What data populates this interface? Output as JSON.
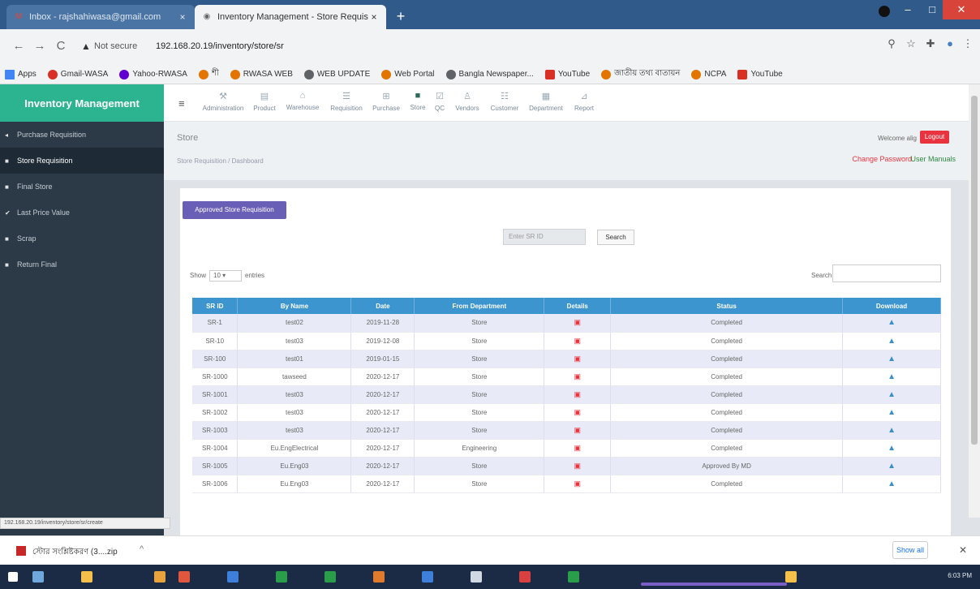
{
  "browser": {
    "tabs": [
      {
        "title": "Inbox - rajshahiwasa@gmail.com",
        "active": false
      },
      {
        "title": "Inventory Management - Store Requisition",
        "active": true
      }
    ],
    "new_tab": "+",
    "controls": {
      "minimize": "–",
      "maximize": "□",
      "close": "✕"
    },
    "nav": {
      "back": "←",
      "forward": "→",
      "reload": "C"
    },
    "security": "Not secure",
    "url": "192.168.20.19/inventory/store/sr",
    "omni_icons": {
      "zoom": "⚲",
      "star": "☆",
      "extensions": "✚",
      "menu": "⋮"
    }
  },
  "bookmarks": [
    {
      "label": "Apps",
      "color": "#4285f4"
    },
    {
      "label": "Gmail-WASA",
      "color": "#d93025"
    },
    {
      "label": "Yahoo-RWASA",
      "color": "#6001d2"
    },
    {
      "label": "শী",
      "color": "#e37400"
    },
    {
      "label": "RWASA WEB",
      "color": "#e37400"
    },
    {
      "label": "WEB UPDATE",
      "color": "#5f6368"
    },
    {
      "label": "Web Portal",
      "color": "#e37400"
    },
    {
      "label": "Bangla Newspaper...",
      "color": "#5f6368"
    },
    {
      "label": "YouTube",
      "color": "#d93025"
    },
    {
      "label": "জাতীয় তথ্য বাতায়ন",
      "color": "#e37400"
    },
    {
      "label": "NCPA",
      "color": "#e37400"
    },
    {
      "label": "YouTube",
      "color": "#d93025"
    }
  ],
  "sidebar": {
    "brand": "Inventory Management",
    "items": [
      {
        "label": "Purchase Requisition",
        "icon": "◂",
        "active": false
      },
      {
        "label": "Store Requisition",
        "icon": "■",
        "active": true
      },
      {
        "label": "Final Store",
        "icon": "■",
        "active": false
      },
      {
        "label": "Last Price Value",
        "icon": "✔",
        "active": false
      },
      {
        "label": "Scrap",
        "icon": "■",
        "active": false
      },
      {
        "label": "Return Final",
        "icon": "■",
        "active": false
      }
    ]
  },
  "topnav": {
    "items": [
      {
        "label": "Administration",
        "icon": "⚒"
      },
      {
        "label": "Product",
        "icon": "▤"
      },
      {
        "label": "Warehouse",
        "icon": "⌂"
      },
      {
        "label": "Requisition",
        "icon": "☰"
      },
      {
        "label": "Purchase",
        "icon": "⊞"
      },
      {
        "label": "Store",
        "icon": "■",
        "active": true
      },
      {
        "label": "QC",
        "icon": "☑"
      },
      {
        "label": "Vendors",
        "icon": "♙"
      },
      {
        "label": "Customer",
        "icon": "☷"
      },
      {
        "label": "Department",
        "icon": "▦"
      },
      {
        "label": "Report",
        "icon": "⊿"
      }
    ]
  },
  "pagehead": {
    "title": "Store",
    "breadcrumb": "Store Requisition / Dashboard",
    "welcome": "Welcome alig",
    "logout": "Logout",
    "change_password": "Change Password",
    "user_manual": "User Manuals"
  },
  "content": {
    "approved_button": "Approved Store Requisition",
    "sr_placeholder": "Enter SR ID",
    "search_button": "Search",
    "show_label": "Show",
    "show_value": "10",
    "entries_label": "entries",
    "search_label": "Search:"
  },
  "table": {
    "columns": [
      "SR ID",
      "By Name",
      "Date",
      "From Department",
      "Details",
      "Status",
      "Download"
    ],
    "rows": [
      [
        "SR-1",
        "test02",
        "2019-11-28",
        "Store",
        "▣",
        "Completed",
        "▲"
      ],
      [
        "SR-10",
        "test03",
        "2019-12-08",
        "Store",
        "▣",
        "Completed",
        "▲"
      ],
      [
        "SR-100",
        "test01",
        "2019-01-15",
        "Store",
        "▣",
        "Completed",
        "▲"
      ],
      [
        "SR-1000",
        "tawseed",
        "2020-12-17",
        "Store",
        "▣",
        "Completed",
        "▲"
      ],
      [
        "SR-1001",
        "test03",
        "2020-12-17",
        "Store",
        "▣",
        "Completed",
        "▲"
      ],
      [
        "SR-1002",
        "test03",
        "2020-12-17",
        "Store",
        "▣",
        "Completed",
        "▲"
      ],
      [
        "SR-1003",
        "test03",
        "2020-12-17",
        "Store",
        "▣",
        "Completed",
        "▲"
      ],
      [
        "SR-1004",
        "Eu.EngElectrical",
        "2020-12-17",
        "Engineering",
        "▣",
        "Completed",
        "▲"
      ],
      [
        "SR-1005",
        "Eu.Eng03",
        "2020-12-17",
        "Store",
        "▣",
        "Approved By MD",
        "▲"
      ],
      [
        "SR-1006",
        "Eu.Eng03",
        "2020-12-17",
        "Store",
        "▣",
        "Completed",
        "▲"
      ]
    ]
  },
  "status_url": "192.168.20.19/inventory/store/sr/create",
  "download": {
    "file": "স্টোর সংশ্লিষ্টকরণ (3....zip",
    "caret": "^",
    "show_all": "Show all",
    "close": "✕"
  },
  "taskbar": {
    "clock": "6:03 PM"
  }
}
